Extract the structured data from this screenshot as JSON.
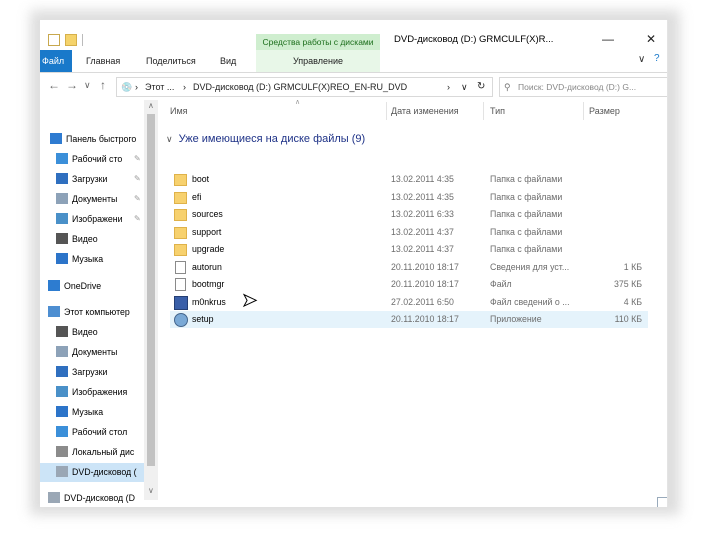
{
  "window": {
    "title": "DVD-дисковод (D:) GRMCULF(X)R...",
    "tools_band": "Средства работы с дисками",
    "minimize": "—",
    "close": "✕"
  },
  "ribbon": {
    "tabs": [
      "Файл",
      "Главная",
      "Поделиться",
      "Вид",
      "Управление"
    ],
    "expand": "∨",
    "help": "?"
  },
  "address": {
    "back": "←",
    "forward": "→",
    "up": "↑",
    "sep": "›",
    "crumb_root": "Этот ...",
    "crumb_drive": "DVD-дисковод (D:) GRMCULF(X)REO_EN-RU_DVD",
    "dropdown": "∨",
    "refresh": "↻",
    "search_placeholder": "Поиск: DVD-дисковод (D:) G..."
  },
  "nav_pane": {
    "items": [
      {
        "label": "Панель быстрого",
        "icon": "star-icon"
      },
      {
        "label": "Рабочий сто",
        "icon": "desktop-icon",
        "pinned": true
      },
      {
        "label": "Загрузки",
        "icon": "download-icon",
        "pinned": true
      },
      {
        "label": "Документы",
        "icon": "documents-icon",
        "pinned": true
      },
      {
        "label": "Изображени",
        "icon": "pictures-icon",
        "pinned": true
      },
      {
        "label": "Видео",
        "icon": "video-icon"
      },
      {
        "label": "Музыка",
        "icon": "music-icon"
      },
      {
        "label": "OneDrive",
        "icon": "cloud-icon"
      },
      {
        "label": "Этот компьютер",
        "icon": "computer-icon"
      },
      {
        "label": "Видео",
        "icon": "video-icon"
      },
      {
        "label": "Документы",
        "icon": "documents-icon"
      },
      {
        "label": "Загрузки",
        "icon": "download-icon"
      },
      {
        "label": "Изображения",
        "icon": "pictures-icon"
      },
      {
        "label": "Музыка",
        "icon": "music-icon"
      },
      {
        "label": "Рабочий стол",
        "icon": "desktop-icon"
      },
      {
        "label": "Локальный дис",
        "icon": "disk-icon"
      },
      {
        "label": "DVD-дисковод (",
        "icon": "dvd-icon",
        "selected": true
      },
      {
        "label": "DVD-дисковод (D",
        "icon": "dvd-icon"
      }
    ],
    "pin_glyph": "✎",
    "scroll_up": "∧",
    "scroll_down": "∨"
  },
  "columns": {
    "name": "Имя",
    "date": "Дата изменения",
    "type": "Тип",
    "size": "Размер",
    "sort_arrow": "∧"
  },
  "group_title": "Уже имеющиеся на диске файлы (9)",
  "group_chevron": "∨",
  "files": [
    {
      "name": "boot",
      "date": "13.02.2011 4:35",
      "type": "Папка с файлами",
      "size": "",
      "icon": "folder-icon"
    },
    {
      "name": "efi",
      "date": "13.02.2011 4:35",
      "type": "Папка с файлами",
      "size": "",
      "icon": "folder-icon"
    },
    {
      "name": "sources",
      "date": "13.02.2011 6:33",
      "type": "Папка с файлами",
      "size": "",
      "icon": "folder-icon"
    },
    {
      "name": "support",
      "date": "13.02.2011 4:37",
      "type": "Папка с файлами",
      "size": "",
      "icon": "folder-icon"
    },
    {
      "name": "upgrade",
      "date": "13.02.2011 4:37",
      "type": "Папка с файлами",
      "size": "",
      "icon": "folder-icon"
    },
    {
      "name": "autorun",
      "date": "20.11.2010 18:17",
      "type": "Сведения для уст...",
      "size": "1 КБ",
      "icon": "settings-file-icon"
    },
    {
      "name": "bootmgr",
      "date": "20.11.2010 18:17",
      "type": "Файл",
      "size": "375 КБ",
      "icon": "file-icon"
    },
    {
      "name": "m0nkrus",
      "date": "27.02.2011 6:50",
      "type": "Файл сведений о ...",
      "size": "4 КБ",
      "icon": "info-file-icon"
    },
    {
      "name": "setup",
      "date": "20.11.2010 18:17",
      "type": "Приложение",
      "size": "110 КБ",
      "icon": "setup-app-icon",
      "highlighted": true
    }
  ],
  "cursor": "➤"
}
